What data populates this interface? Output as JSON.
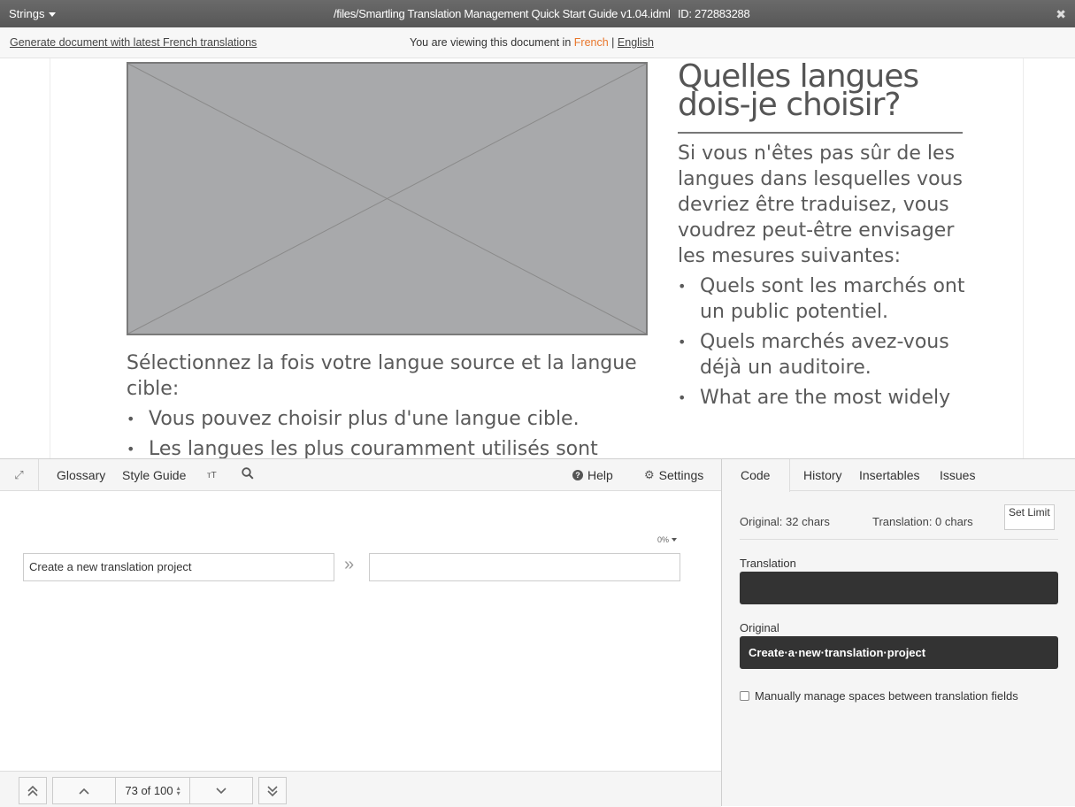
{
  "topbar": {
    "strings_label": "Strings",
    "file_path": "/files/Smartling Translation Management Quick Start Guide v1.04.idml",
    "doc_id": "ID: 272883288",
    "close_icon": "close-icon"
  },
  "notice": {
    "generate_link": "Generate document with latest French translations",
    "viewing_prefix": "You are viewing this document in",
    "lang_current": "French",
    "separator": "|",
    "lang_other": "English"
  },
  "document": {
    "left": {
      "intro": "Sélectionnez la fois votre langue source et la langue cible:",
      "bullets": [
        "Vous pouvez choisir plus d'une langue cible.",
        "Les langues les plus couramment utilisés sont"
      ]
    },
    "right": {
      "heading": "Quelles langues dois-je choisir?",
      "paragraph": "Si vous n'êtes pas sûr de les langues dans lesquelles vous devriez être traduisez, vous voudrez peut-être envisager les mesures suivantes:",
      "bullets": [
        "Quels sont les marchés ont un public potentiel.",
        "Quels marchés avez-vous déjà un auditoire.",
        "What are the most widely"
      ]
    }
  },
  "editor": {
    "toolbar": {
      "expand_icon": "expand-icon",
      "glossary": "Glossary",
      "style_guide": "Style Guide",
      "text_size": "тT",
      "search_icon": "search-icon",
      "help": "Help",
      "settings": "Settings"
    },
    "fuzzy_match": "0%",
    "source_text": "Create a new translation project",
    "target_text": "",
    "pagination": {
      "page": "73 of 100"
    }
  },
  "panel": {
    "tabs": [
      "Code",
      "History",
      "Insertables",
      "Issues"
    ],
    "original_count": "Original: 32 chars",
    "translation_count": "Translation: 0 chars",
    "set_limit": "Set Limit",
    "translation_label": "Translation",
    "translation_value": "",
    "original_label": "Original",
    "original_value": "Create·a·new·translation·project",
    "manual_spaces": "Manually manage spaces between translation fields"
  }
}
